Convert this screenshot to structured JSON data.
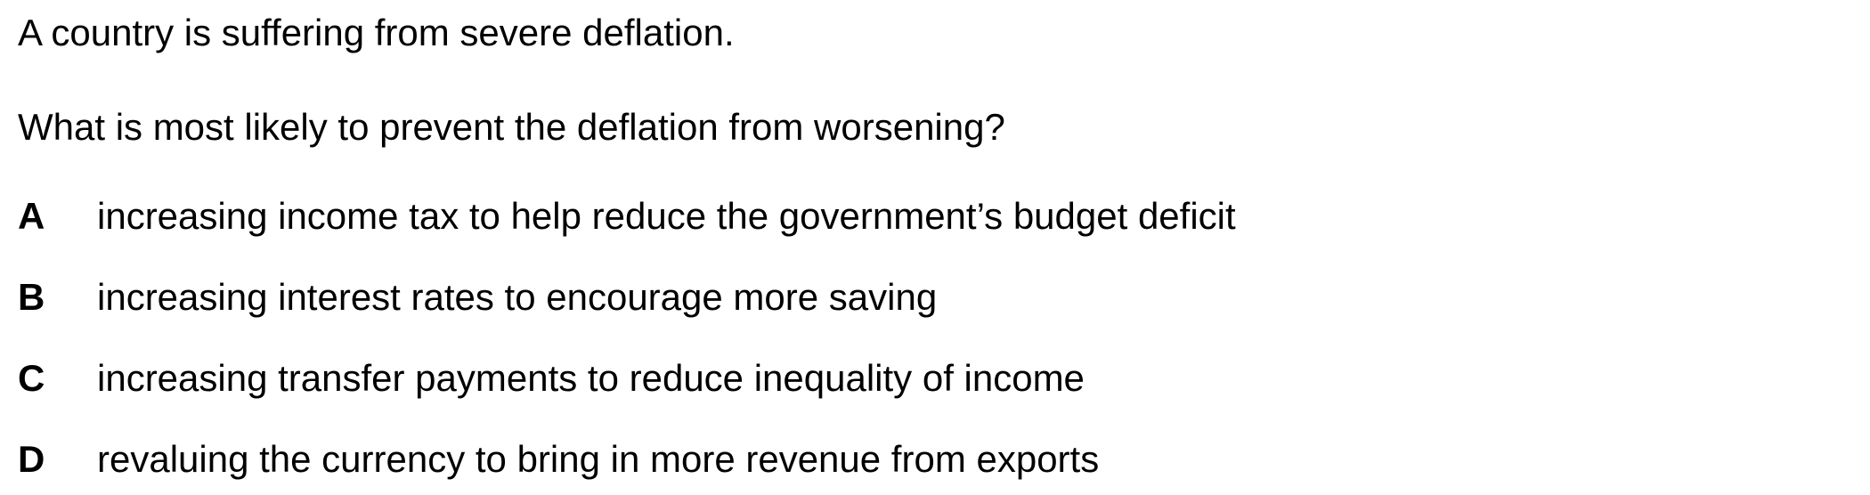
{
  "question": {
    "stem": "A country is suffering from severe deflation.",
    "prompt": "What is most likely to prevent the deflation from worsening?",
    "options": [
      {
        "letter": "A",
        "text": "increasing income tax to help reduce the government’s budget deficit"
      },
      {
        "letter": "B",
        "text": "increasing interest rates to encourage more saving"
      },
      {
        "letter": "C",
        "text": "increasing transfer payments to reduce inequality of income"
      },
      {
        "letter": "D",
        "text": "revaluing the currency to bring in more revenue from exports"
      }
    ]
  }
}
